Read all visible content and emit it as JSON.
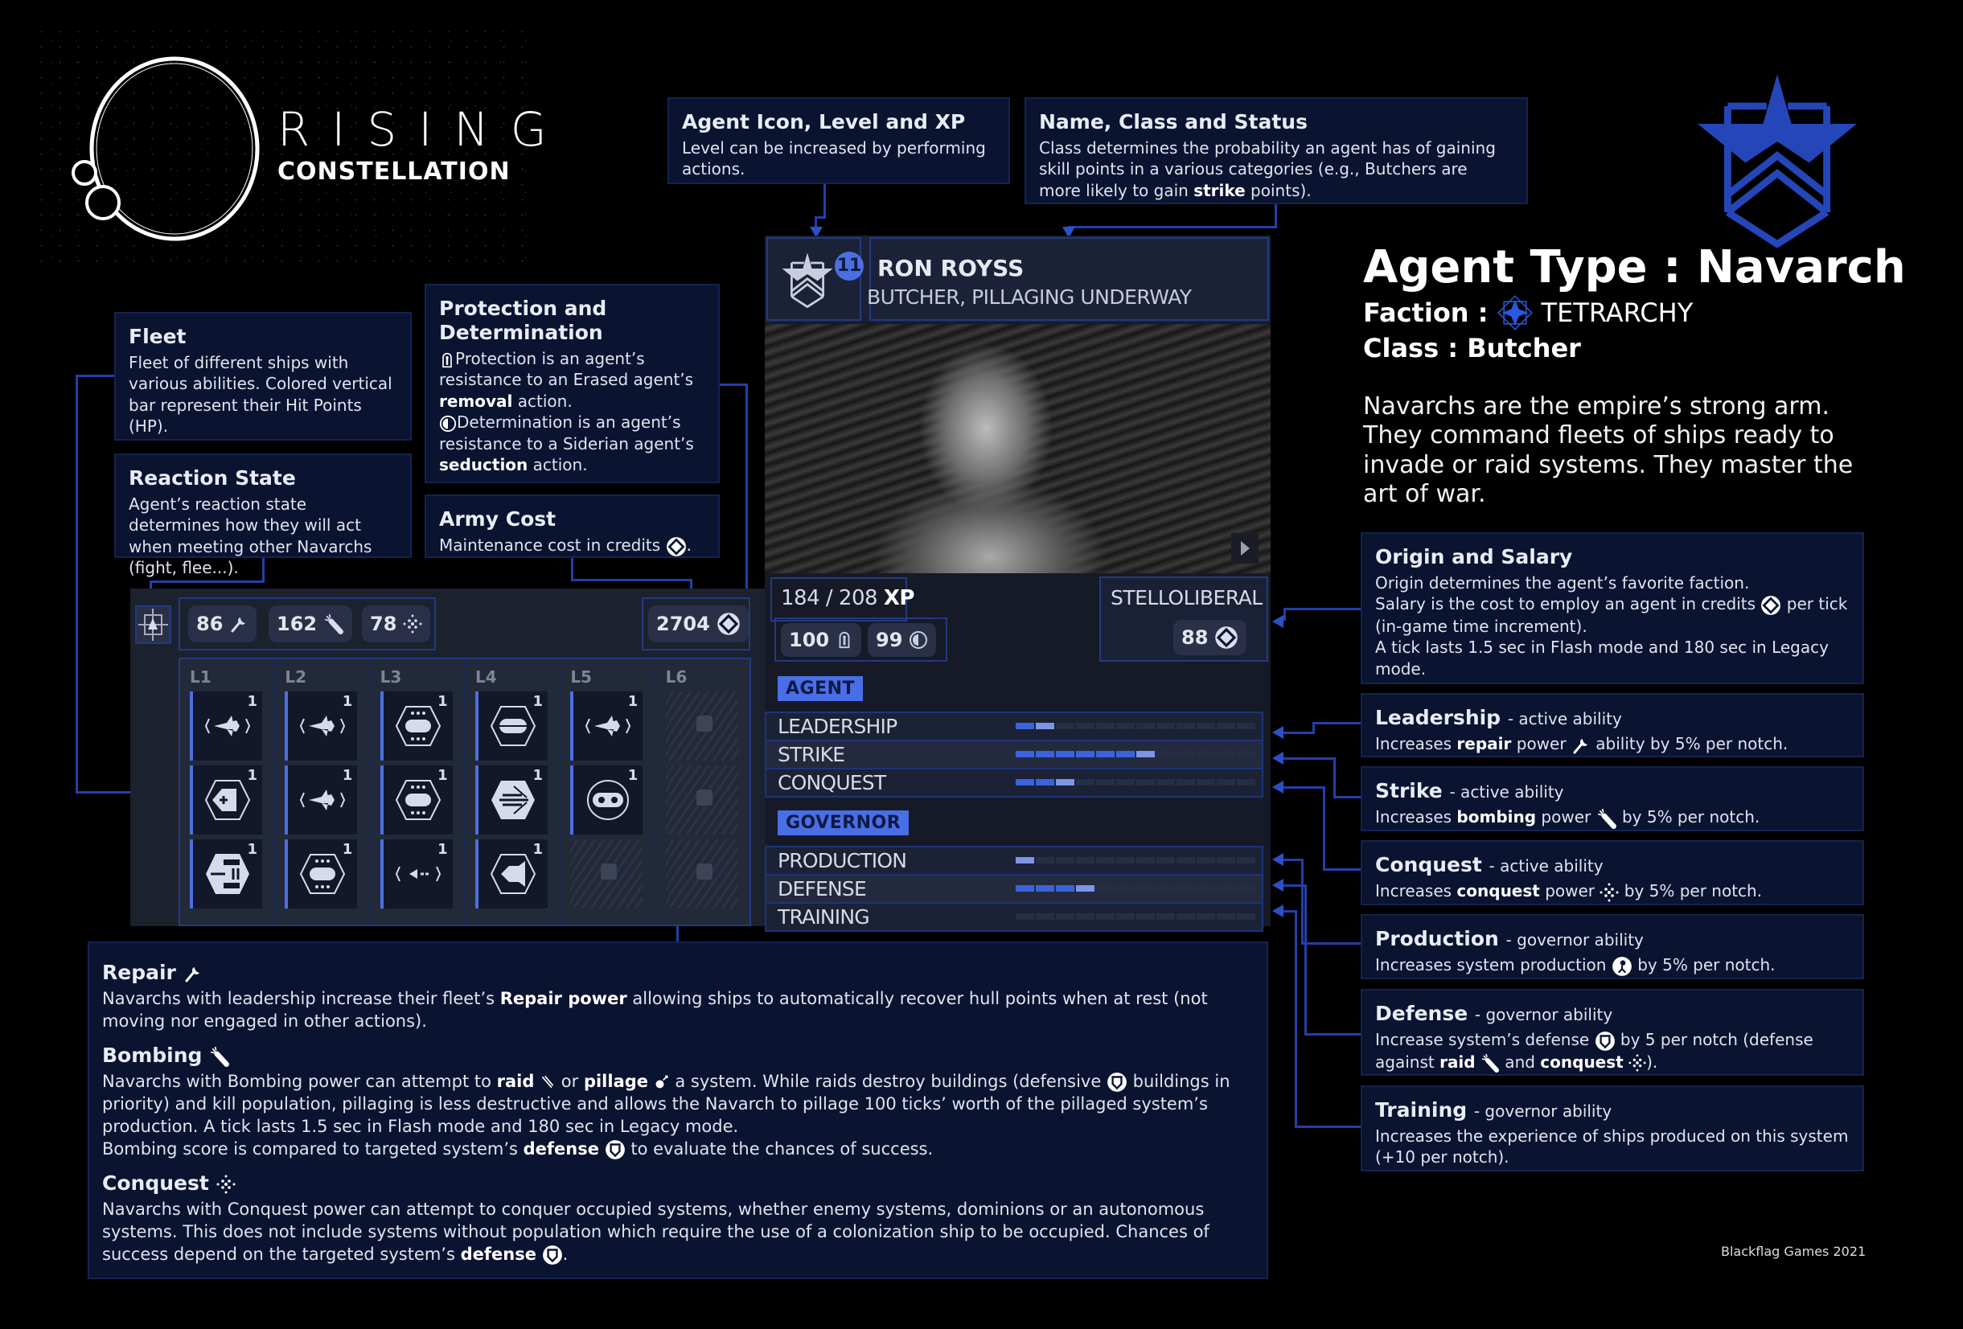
{
  "logo": {
    "line1": "RISING",
    "line2": "CONSTELLATION"
  },
  "callouts": {
    "agent_icon": {
      "title": "Agent Icon, Level and XP",
      "text": "Level can be increased by performing actions."
    },
    "name_class": {
      "title": "Name, Class and Status",
      "text_before": "Class determines the probability an agent has of gaining skill points in a various categories (e.g., Butchers are more likely to gain ",
      "bold": "strike",
      "text_after": " points)."
    },
    "fleet": {
      "title": "Fleet",
      "text": "Fleet of different ships with various abilities. Colored vertical bar represent their Hit Points (HP)."
    },
    "reaction": {
      "title": "Reaction State",
      "text": "Agent’s reaction state determines how they will act when meeting other Navarchs (fight, flee...)."
    },
    "protection": {
      "title": "Protection and Determination",
      "p1": "Protection is an agent’s resistance to an Erased agent’s ",
      "p1_bold": "removal",
      "p1_end": " action.",
      "p2": "Determination is an agent’s resistance to a Siderian agent’s ",
      "p2_bold": "seduction",
      "p2_end": " action."
    },
    "army_cost": {
      "title": "Army Cost",
      "text": "Maintenance cost in credits",
      "end": "."
    }
  },
  "agent_card": {
    "level": "11",
    "name": "RON ROYSS",
    "status": "BUTCHER, PILLAGING UNDERWAY",
    "xp_current": "184 / 208",
    "xp_unit": "XP",
    "protection": "100",
    "determination": "99",
    "origin": "STELLOLIBERAL",
    "salary": "88",
    "sections": [
      {
        "tag": "AGENT",
        "skills": [
          {
            "name": "LEADERSHIP",
            "value": 2,
            "max": 12
          },
          {
            "name": "STRIKE",
            "value": 7,
            "max": 12
          },
          {
            "name": "CONQUEST",
            "value": 3,
            "max": 12
          }
        ]
      },
      {
        "tag": "GOVERNOR",
        "skills": [
          {
            "name": "PRODUCTION",
            "value": 1,
            "max": 12
          },
          {
            "name": "DEFENSE",
            "value": 4,
            "max": 12
          },
          {
            "name": "TRAINING",
            "value": 0,
            "max": 12
          }
        ]
      }
    ]
  },
  "fleet_panel": {
    "repair": "86",
    "bombing": "162",
    "conquest": "78",
    "army_cost": "2704",
    "columns": [
      {
        "label": "L1",
        "ships": [
          "fighter",
          "medic",
          "carrier"
        ]
      },
      {
        "label": "L2",
        "ships": [
          "fighter",
          "fighter",
          "cruiser"
        ]
      },
      {
        "label": "L3",
        "ships": [
          "cruiser",
          "cruiser",
          "scout"
        ]
      },
      {
        "label": "L4",
        "ships": [
          "frigate",
          "destroyer",
          "bomber"
        ]
      },
      {
        "label": "L5",
        "ships": [
          "fighter",
          "pod",
          "locked"
        ]
      },
      {
        "label": "L6",
        "ships": [
          "locked",
          "locked",
          "locked"
        ]
      }
    ],
    "ship_count": "1"
  },
  "header": {
    "title": "Agent Type : Navarch",
    "faction_label": "Faction :",
    "faction": "TETRARCHY",
    "class_label": "Class :",
    "class": "Butcher",
    "description": "Navarchs are the empire’s strong arm. They command fleets of ships ready to invade or raid systems. They master the art of war.",
    "accent_color": "#2a4fc8"
  },
  "right": {
    "origin": {
      "title": "Origin and Salary",
      "l1": "Origin determines the agent’s favorite faction.",
      "l2a": "Salary is the cost to employ an agent in credits",
      "l2b": "per tick (in-game time increment).",
      "l3": "A tick lasts 1.5 sec in Flash mode and 180 sec in Legacy mode."
    },
    "leadership": {
      "title": "Leadership",
      "sub": "- active ability",
      "a": "Increases ",
      "b": "repair",
      "c": " power",
      "d": "ability by 5% per notch."
    },
    "strike": {
      "title": "Strike",
      "sub": "- active ability",
      "a": "Increases ",
      "b": "bombing",
      "c": " power",
      "d": "by 5% per notch."
    },
    "conquest": {
      "title": "Conquest",
      "sub": "- active ability",
      "a": "Increases ",
      "b": "conquest",
      "c": " power",
      "d": "by  5% per notch."
    },
    "production": {
      "title": "Production",
      "sub": "- governor ability",
      "a": "Increases system production",
      "d": "by 5% per notch."
    },
    "defense": {
      "title": "Defense",
      "sub": "- governor ability",
      "a": "Increase system’s defense",
      "d": "by 5 per notch (defense against ",
      "b": "raid",
      "e": " and ",
      "f": "conquest",
      "g": ")."
    },
    "training": {
      "title": "Training",
      "sub": "- governor ability",
      "a": "Increases the experience of ships produced on this system (+10 per notch)."
    }
  },
  "bottom": {
    "repair": {
      "title": "Repair",
      "a": "Navarchs with leadership increase their fleet’s ",
      "b": "Repair power",
      "c": " allowing ships to automatically recover hull points when at rest (not moving nor engaged in other actions)."
    },
    "bombing": {
      "title": "Bombing",
      "a": "Navarchs with Bombing power can attempt to ",
      "raid": "raid",
      "or": " or ",
      "pillage": "pillage",
      "c": " a system. While raids destroy buildings (defensive",
      "d": " buildings in priority) and kill population, pillaging is less destructive and allows the Navarch to pillage 100 ticks’ worth of the pillaged system’s production. A tick lasts 1.5 sec in Flash mode and 180 sec in Legacy mode.",
      "e": "Bombing score is compared to targeted system’s ",
      "f": "defense",
      "g": " to evaluate the chances of success."
    },
    "conquest": {
      "title": "Conquest",
      "a": "Navarchs with Conquest power can attempt to conquer occupied systems, whether enemy systems, dominions or an autonomous systems. This does not include systems without population which require the use of a colonization ship to be occupied. Chances of success depend on the targeted system’s ",
      "b": "defense",
      "c": "."
    }
  },
  "footer": {
    "copyright": "Blackflag Games 2021"
  }
}
